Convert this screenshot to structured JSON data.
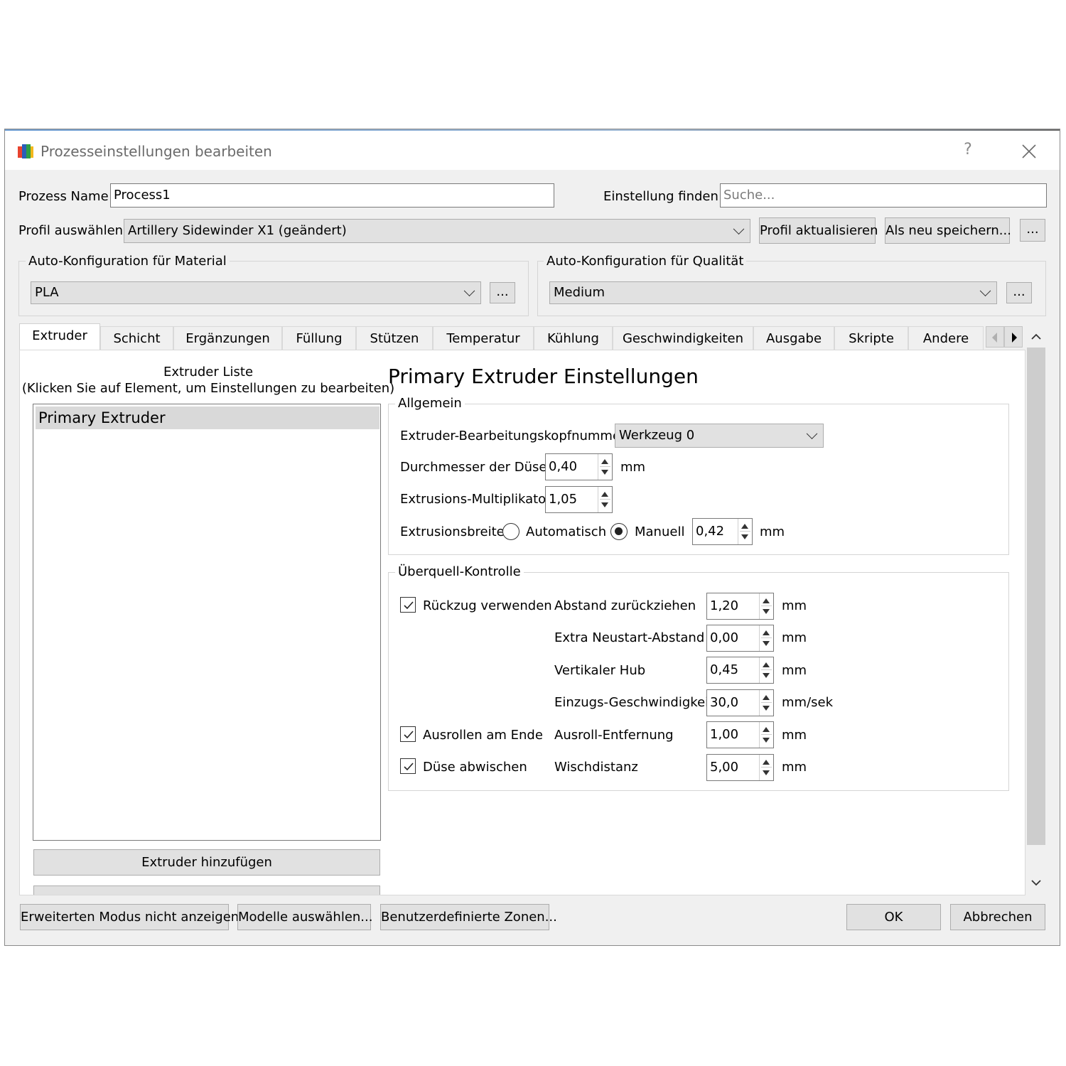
{
  "window": {
    "title": "Prozesseinstellungen bearbeiten",
    "help_glyph": "?"
  },
  "header": {
    "process_name_label": "Prozess Name",
    "process_name_value": "Process1",
    "find_label": "Einstellung finden:",
    "find_placeholder": "Suche...",
    "profile_label": "Profil auswählen",
    "profile_value": "Artillery Sidewinder X1 (geändert)",
    "update_profile_button": "Profil aktualisieren",
    "save_as_new_button": "Als neu speichern...",
    "more_button": "..."
  },
  "auto_config": {
    "material": {
      "title": "Auto-Konfiguration für Material",
      "value": "PLA",
      "more": "..."
    },
    "quality": {
      "title": "Auto-Konfiguration für Qualität",
      "value": "Medium",
      "more": "..."
    }
  },
  "tabs": [
    {
      "label": "Extruder",
      "active": true
    },
    {
      "label": "Schicht"
    },
    {
      "label": "Ergänzungen"
    },
    {
      "label": "Füllung"
    },
    {
      "label": "Stützen"
    },
    {
      "label": "Temperatur"
    },
    {
      "label": "Kühlung"
    },
    {
      "label": "Geschwindigkeiten"
    },
    {
      "label": "Ausgabe"
    },
    {
      "label": "Skripte"
    },
    {
      "label": "Andere"
    }
  ],
  "extruder_panel": {
    "list_title_line1": "Extruder Liste",
    "list_title_line2": "(Klicken Sie auf Element, um Einstellungen zu bearbeiten)",
    "items": [
      "Primary Extruder"
    ],
    "add_button": "Extruder hinzufügen"
  },
  "settings": {
    "heading": "Primary Extruder Einstellungen",
    "general": {
      "title": "Allgemein",
      "toolhead_label": "Extruder-Bearbeitungskopfnummer",
      "toolhead_value": "Werkzeug 0",
      "nozzle_diameter_label": "Durchmesser der Düse",
      "nozzle_diameter_value": "0,40",
      "nozzle_diameter_unit": "mm",
      "multiplier_label": "Extrusions-Multiplikator",
      "multiplier_value": "1,05",
      "width_label": "Extrusionsbreite",
      "width_auto_label": "Automatisch",
      "width_manual_label": "Manuell",
      "width_mode": "manual",
      "width_value": "0,42",
      "width_unit": "mm"
    },
    "ooze": {
      "title": "Überquell-Kontrolle",
      "retraction_label": "Rückzug verwenden",
      "retraction_checked": true,
      "coast_label": "Ausrollen am Ende",
      "coast_checked": true,
      "wipe_label": "Düse abwischen",
      "wipe_checked": true,
      "rows": [
        {
          "label": "Abstand zurückziehen",
          "value": "1,20",
          "unit": "mm"
        },
        {
          "label": "Extra Neustart-Abstand",
          "value": "0,00",
          "unit": "mm"
        },
        {
          "label": "Vertikaler Hub",
          "value": "0,45",
          "unit": "mm"
        },
        {
          "label": "Einzugs-Geschwindigkeit",
          "value": "30,0",
          "unit": "mm/sek"
        },
        {
          "label": "Ausroll-Entfernung",
          "value": "1,00",
          "unit": "mm"
        },
        {
          "label": "Wischdistanz",
          "value": "5,00",
          "unit": "mm"
        }
      ]
    }
  },
  "footer": {
    "hide_advanced_button": "Erweiterten Modus nicht anzeigen",
    "select_models_button": "Modelle auswählen...",
    "custom_zones_button": "Benutzerdefinierte Zonen...",
    "ok_button": "OK",
    "cancel_button": "Abbrechen"
  }
}
